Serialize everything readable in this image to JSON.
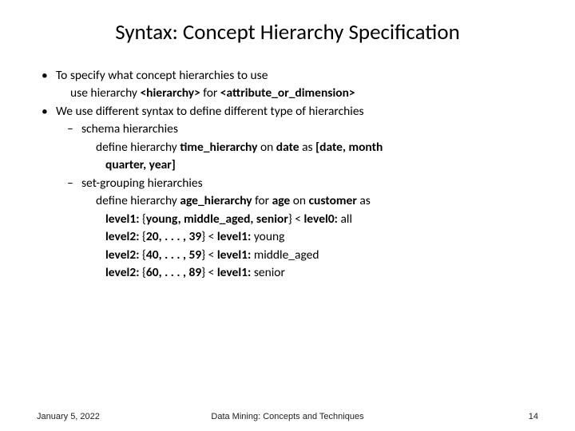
{
  "title": "Syntax: Concept Hierarchy Specification",
  "b1": "To specify what concept hierarchies to use",
  "b1s": {
    "a": "use hierarchy ",
    "b": "<hierarchy>",
    "c": " for ",
    "d": "<attribute_or_dimension>"
  },
  "b2": "We use different syntax to define different type of hierarchies",
  "b2a": "schema hierarchies",
  "b2a1": {
    "a": "define hierarchy ",
    "b": "time_hierarchy",
    "c": " on ",
    "d": "date",
    "e": " as ",
    "f": "[date, month"
  },
  "b2a2": "quarter, year]",
  "b2b": "set-grouping hierarchies",
  "b2b1": {
    "a": "define hierarchy ",
    "b": "age_hierarchy",
    "c": " for ",
    "d": "age",
    "e": " on ",
    "f": "customer",
    "g": " as"
  },
  "lv1": {
    "a": "level1: ",
    "b": "{",
    "c": "young, middle_aged, senior",
    "d": "} < ",
    "e": "level0: ",
    "f": "all"
  },
  "lv2": {
    "a": "level2: ",
    "b": "{",
    "c": "20, . . . , 39",
    "d": "} < ",
    "e": "level1: ",
    "f": "young"
  },
  "lv3": {
    "a": "level2: ",
    "b": "{",
    "c": "40, . . . , 59",
    "d": "} < ",
    "e": "level1: ",
    "f": "middle_aged"
  },
  "lv4": {
    "a": "level2: ",
    "b": "{",
    "c": "60, . . . , 89",
    "d": "} < ",
    "e": "level1: ",
    "f": "senior"
  },
  "footer": {
    "date": "January 5, 2022",
    "center": "Data Mining: Concepts and Techniques",
    "page": "14"
  }
}
